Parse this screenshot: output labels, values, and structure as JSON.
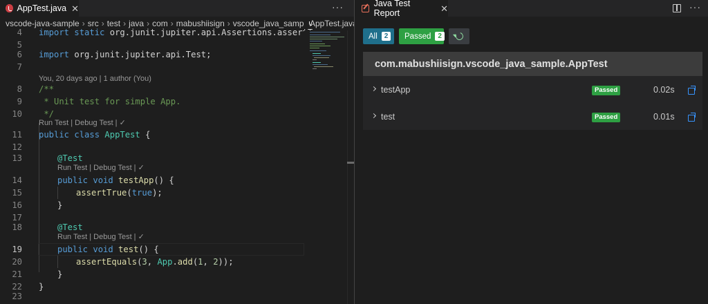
{
  "editor": {
    "tab": {
      "label": "AppTest.java",
      "close": "✕"
    },
    "more": "···",
    "breadcrumb": [
      "vscode-java-sample",
      "src",
      "test",
      "java",
      "com",
      "mabushiisign",
      "vscode_java_sample",
      "AppTest.java"
    ],
    "breadcrumb_sep": "›",
    "line_numbers": [
      "4",
      "5",
      "6",
      "7",
      "8",
      "9",
      "10",
      "11",
      "12",
      "13",
      "14",
      "15",
      "16",
      "17",
      "18",
      "19",
      "20",
      "21",
      "22",
      "23"
    ],
    "code": {
      "l4_kw": "import static",
      "l4_rest": " org.junit.jupiter.api.Assertions.assertTrue;",
      "l6_kw": "import",
      "l6_rest": " org.junit.jupiter.api.Test;",
      "blame": "You, 20 days ago | 1 author (You)",
      "l8": "/**",
      "l9": " * Unit test for simple App.",
      "l10": " */",
      "lens_class": "Run Test | Debug Test | ✓",
      "l11_kw": "public class",
      "l11_cls": " AppTest",
      "l11_rest": " {",
      "l13_ann": "@Test",
      "lens_test1": "Run Test | Debug Test | ✓",
      "l14_kw": "public void",
      "l14_fn": " testApp",
      "l14_rest": "() {",
      "l15_fn": "assertTrue",
      "l15_p1": "(",
      "l15_kw": "true",
      "l15_p2": ");",
      "l16": "}",
      "l18_ann": "@Test",
      "lens_test2": "Run Test | Debug Test | ✓",
      "l19_kw": "public void",
      "l19_fn": " test",
      "l19_rest": "() {",
      "l20_fn": "assertEquals",
      "l20_p1": "(",
      "l20_n1": "3",
      "l20_p2": ", ",
      "l20_cls": "App",
      "l20_p3": ".",
      "l20_fn2": "add",
      "l20_p4": "(",
      "l20_n2": "1",
      "l20_p5": ", ",
      "l20_n3": "2",
      "l20_p6": "));",
      "l21": "}",
      "l22": "}"
    }
  },
  "report": {
    "tab": {
      "label": "Java Test Report",
      "close": "✕"
    },
    "more": "···",
    "filters": {
      "all_label": "All",
      "all_count": "2",
      "passed_label": "Passed",
      "passed_count": "2"
    },
    "suite": "com.mabushiisign.vscode_java_sample.AppTest",
    "tests": [
      {
        "name": "testApp",
        "status": "Passed",
        "duration": "0.02s"
      },
      {
        "name": "test",
        "status": "Passed",
        "duration": "0.01s"
      }
    ]
  }
}
